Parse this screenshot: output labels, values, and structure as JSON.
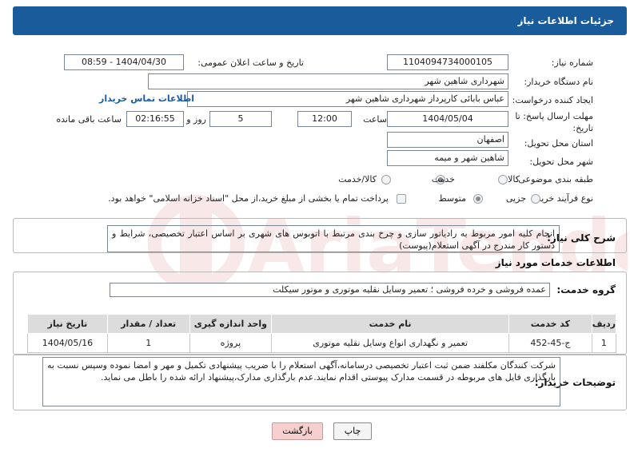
{
  "header": {
    "title": "جزئیات اطلاعات نیاز"
  },
  "form": {
    "need_number_label": "شماره نیاز:",
    "need_number": "1104094734000105",
    "announce_label": "تاریخ و ساعت اعلان عمومی:",
    "announce_value": "1404/04/30 - 08:59",
    "buyer_label": "نام دستگاه خریدار:",
    "buyer_value": "شهرداری شاهین شهر",
    "creator_label": "ایجاد کننده درخواست:",
    "creator_value": "عباس بابائی کارپرداز شهرداری شاهین شهر",
    "contact_link": "اطلاعات تماس خریدار",
    "deadline_label": "مهلت ارسال پاسخ: تا تاریخ:",
    "deadline_date": "1404/05/04",
    "hour_label": "ساعت",
    "deadline_time": "12:00",
    "days_value": "5",
    "days_label": "روز و",
    "remaining_value": "02:16:55",
    "remaining_label": "ساعت باقی مانده",
    "province_label": "استان محل تحویل:",
    "province_value": "اصفهان",
    "city_label": "شهر محل تحویل:",
    "city_value": "شاهین شهر و میمه",
    "category_label": "طبقه بندی موضوعی:",
    "category_options": [
      "کالا",
      "خدمت",
      "کالا/خدمت"
    ],
    "process_label": "نوع فرآیند خرید :",
    "process_options": [
      "جزیی",
      "متوسط"
    ],
    "payment_note": "پرداخت تمام یا بخشی از مبلغ خرید،از محل \"اسناد خزانه اسلامی\" خواهد بود."
  },
  "description": {
    "label": "شرح کلی نیاز:",
    "text": "انجام کلیه امور مربوط به رادیاتور سازی و چرخ بندی مرتبط با اتوبوس های شهری بر اساس اعتبار تخصیصی، شرایط و دستور کار مندرج در آگهی استعلام(پیوست)"
  },
  "services": {
    "section_title": "اطلاعات خدمات مورد نیاز",
    "group_label": "گروه خدمت:",
    "group_value": "عمده فروشی و خرده فروشی ؛ تعمیر وسایل نقلیه موتوری و موتور سیکلت",
    "columns": [
      "ردیف",
      "کد خدمت",
      "نام خدمت",
      "واحد اندازه گیری",
      "تعداد / مقدار",
      "تاریخ نیاز"
    ],
    "rows": [
      [
        "1",
        "ج-45-452",
        "تعمیر و نگهداری انواع وسایل نقلیه موتوری",
        "پروژه",
        "1",
        "1404/05/16"
      ]
    ]
  },
  "buyer_notes": {
    "label": "توضیحات خریدار:",
    "text": "شرکت کنندگان مکلفند ضمن ثبت اعتبار تخصیصی درسامانه،آگهی استعلام را با ضریب پیشنهادی تکمیل و مهر و امضا نموده وسپس نسبت به بارگذاری فایل های مربوطه در قسمت مدارک پیوستی اقدام نمایند.عدم بارگذاری مدارک،پیشنهاد ارائه شده را باطل می نماید."
  },
  "buttons": {
    "print": "چاپ",
    "back": "بازگشت"
  },
  "colors": {
    "header": "#1a5b9c",
    "link": "#1a5ba6",
    "back_button": "#f7cfcf",
    "watermark": "#c62828"
  }
}
